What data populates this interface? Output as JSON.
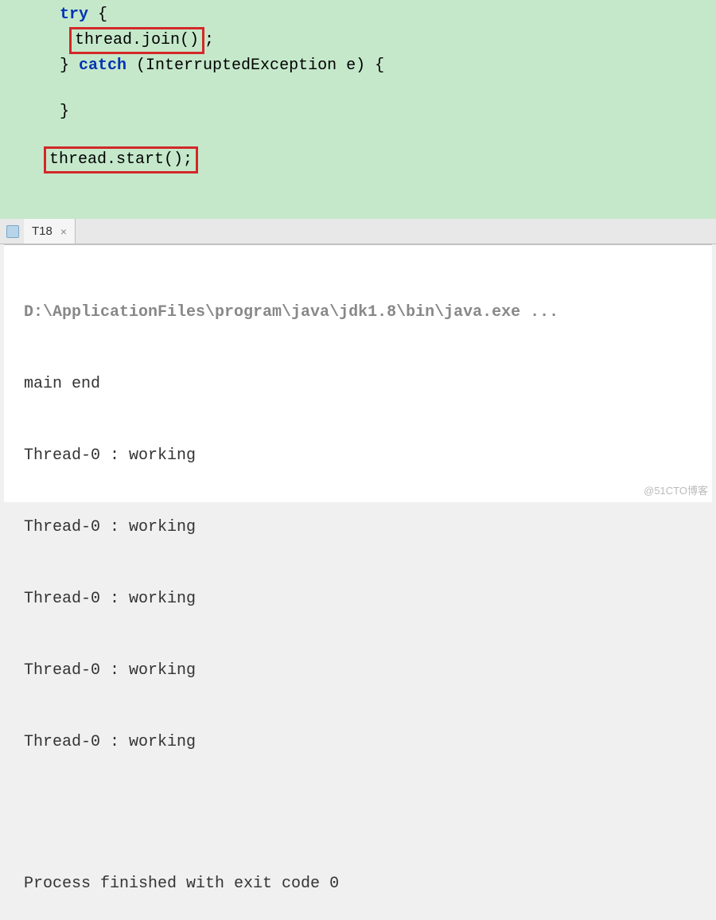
{
  "code": {
    "try_kw": "try",
    "try_brace": " {",
    "join_call": "thread.join()",
    "join_semi": ";",
    "catch_close": "} ",
    "catch_kw": "catch",
    "catch_params": " (InterruptedException e) {",
    "catch_end": "}",
    "start_call": "thread.start();"
  },
  "tab": {
    "name": "T18",
    "close": "×"
  },
  "console": {
    "header": "D:\\ApplicationFiles\\program\\java\\jdk1.8\\bin\\java.exe ...",
    "lines": [
      "main end",
      "Thread-0 : working",
      "Thread-0 : working",
      "Thread-0 : working",
      "Thread-0 : working",
      "Thread-0 : working"
    ],
    "exit": "Process finished with exit code 0"
  },
  "watermark": "@51CTO博客"
}
